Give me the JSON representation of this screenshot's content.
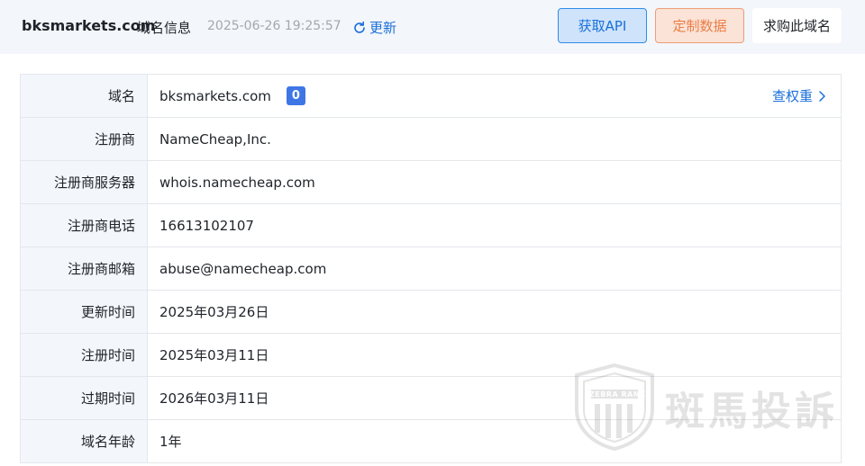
{
  "header": {
    "domain": "bksmarkets.com",
    "suffix": "域名信息",
    "timestamp": "2025-06-26 19:25:57",
    "refresh_label": "更新",
    "buttons": {
      "api": "获取API",
      "custom": "定制数据",
      "buy": "求购此域名"
    }
  },
  "rows": [
    {
      "label": "域名",
      "value": "bksmarkets.com",
      "badge": "0",
      "link": "查权重"
    },
    {
      "label": "注册商",
      "value": "NameCheap,Inc."
    },
    {
      "label": "注册商服务器",
      "value": "whois.namecheap.com"
    },
    {
      "label": "注册商电话",
      "value": "16613102107"
    },
    {
      "label": "注册商邮箱",
      "value": "abuse@namecheap.com"
    },
    {
      "label": "更新时间",
      "value": "2025年03月26日"
    },
    {
      "label": "注册时间",
      "value": "2025年03月11日"
    },
    {
      "label": "过期时间",
      "value": "2026年03月11日"
    },
    {
      "label": "域名年龄",
      "value": "1年"
    }
  ],
  "watermark": {
    "brand": "ZEBRA RANK",
    "text": "斑馬投訴"
  },
  "colors": {
    "accent": "#1a6fd9",
    "orange": "#ea7d45",
    "badge": "#3f76e6",
    "label_bg": "#f3f6fa"
  }
}
